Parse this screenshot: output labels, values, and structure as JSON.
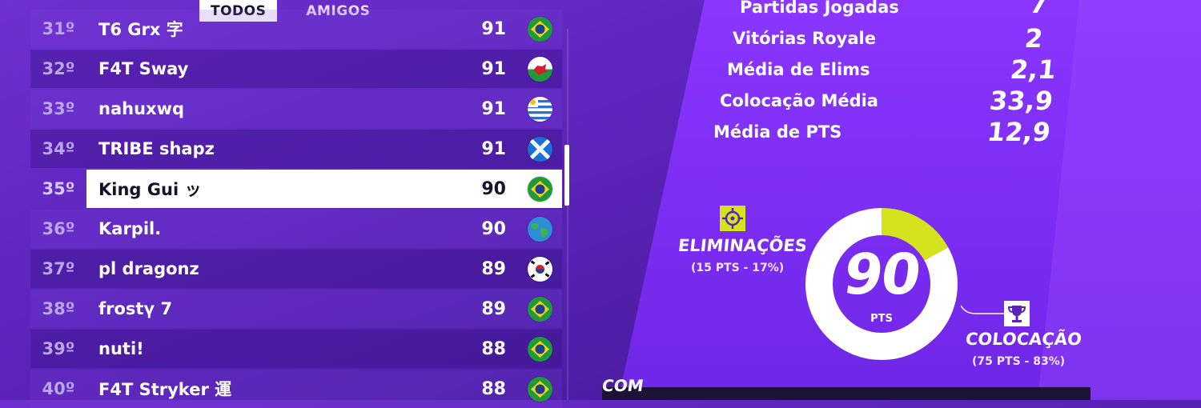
{
  "tabs": [
    {
      "label": "TODOS",
      "active": true
    },
    {
      "label": "AMIGOS",
      "active": false
    }
  ],
  "leaderboard": [
    {
      "rank": "31º",
      "name": "T6 Grx 字",
      "score": "91",
      "flag": "brazil-flag-icon",
      "partial": true
    },
    {
      "rank": "32º",
      "name": "F4T Sway",
      "score": "91",
      "flag": "wales-flag-icon"
    },
    {
      "rank": "33º",
      "name": "nahuxwq",
      "score": "91",
      "flag": "uruguay-flag-icon"
    },
    {
      "rank": "34º",
      "name": "TRIBE shapz",
      "score": "91",
      "flag": "scotland-flag-icon"
    },
    {
      "rank": "35º",
      "name": "King Gui ッ",
      "score": "90",
      "flag": "brazil-flag-icon",
      "highlighted": true
    },
    {
      "rank": "36º",
      "name": "Karpil.",
      "score": "90",
      "flag": "globe-icon"
    },
    {
      "rank": "37º",
      "name": "pl dragonz",
      "score": "89",
      "flag": "south-korea-flag-icon"
    },
    {
      "rank": "38º",
      "name": "frostү 7",
      "score": "89",
      "flag": "brazil-flag-icon"
    },
    {
      "rank": "39º",
      "name": "nuti!",
      "score": "88",
      "flag": "brazil-flag-icon"
    },
    {
      "rank": "40º",
      "name": "F4T Stryker 運",
      "score": "88",
      "flag": "brazil-flag-icon"
    }
  ],
  "stats": [
    {
      "label": "Partidas Jogadas",
      "value": "7"
    },
    {
      "label": "Vitórias Royale",
      "value": "2"
    },
    {
      "label": "Média de Elims",
      "value": "2,1"
    },
    {
      "label": "Colocação Média",
      "value": "33,9"
    },
    {
      "label": "Média de PTS",
      "value": "12,9"
    }
  ],
  "points": {
    "total": "90",
    "unit": "PTS",
    "eliminations": {
      "title": "ELIMINAÇÕES",
      "detail": "(15 PTS - 17%)",
      "fraction": 0.17,
      "icon": "crosshair-icon"
    },
    "placement": {
      "title": "COLOCAÇÃO",
      "detail": "(75 PTS - 83%)",
      "fraction": 0.83,
      "icon": "trophy-icon"
    }
  },
  "footer_badge": "COM",
  "colors": {
    "background": "#5a24b8",
    "panel": "#7b2ff0",
    "eliminations": "#d4e31e",
    "placement": "#ffffff",
    "highlight_row": "#ffffff",
    "text_dark": "#15112e"
  }
}
